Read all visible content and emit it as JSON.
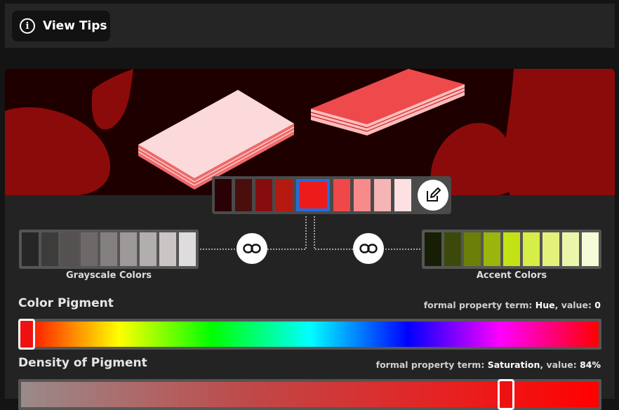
{
  "toolbar": {
    "tips_label": "View Tips",
    "tips_icon": "info-icon"
  },
  "palette": {
    "main_swatches": [
      "#2a0206",
      "#4a0f0c",
      "#860c10",
      "#b5190f",
      "#ee1b1b",
      "#f04848",
      "#f78a8a",
      "#f5b5b5",
      "#fde0e2"
    ],
    "selected_index": 4,
    "edit_icon": "pencil-edit-icon"
  },
  "grayscale": {
    "label": "Grayscale Colors",
    "swatches": [
      "#262626",
      "#3e3b3b",
      "#555151",
      "#6e6868",
      "#858080",
      "#9e9999",
      "#b3aeae",
      "#c9c5c5",
      "#dedcdc"
    ],
    "link_icon": "link-icon"
  },
  "accent": {
    "label": "Accent Colors",
    "swatches": [
      "#161e06",
      "#3b4a0b",
      "#6b7f09",
      "#9bb50d",
      "#c4e215",
      "#d6ee47",
      "#e2f27b",
      "#ecf6ab",
      "#f5fbd8"
    ],
    "link_icon": "link-icon"
  },
  "hue": {
    "title": "Color Pigment",
    "term_prefix": "formal property term:",
    "term_name": "Hue",
    "value_prefix": ", value:",
    "value": "0",
    "fraction": 0
  },
  "saturation": {
    "title": "Density of Pigment",
    "term_prefix": "formal property term:",
    "term_name": "Saturation",
    "value_prefix": ", value:",
    "value": "84%",
    "fraction": 0.84
  }
}
